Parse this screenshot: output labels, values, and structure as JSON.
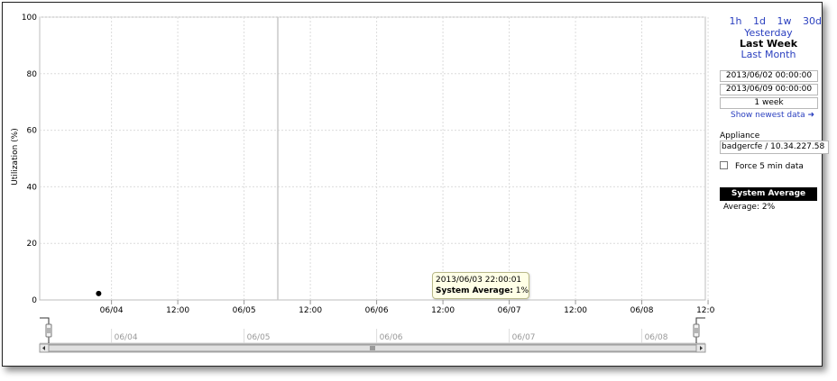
{
  "chart": {
    "ylabel": "Utilization (%)",
    "ylim": [
      0,
      100
    ],
    "y_ticks": [
      "100",
      "80",
      "60",
      "40",
      "20",
      "0"
    ],
    "x_ticks": [
      "06/04",
      "12:00",
      "06/05",
      "12:00",
      "06/06",
      "12:00",
      "06/07",
      "12:00",
      "06/08",
      "12:00"
    ],
    "navigator_ticks": [
      "06/04",
      "06/05",
      "06/06",
      "06/07",
      "06/08"
    ],
    "grid": true
  },
  "chart_data": {
    "type": "scatter",
    "xlabel": "",
    "ylabel": "Utilization (%)",
    "ylim": [
      0,
      100
    ],
    "series": [
      {
        "name": "System Average",
        "x": [
          "2013/06/03 22:00:01"
        ],
        "y": [
          1
        ]
      }
    ]
  },
  "tooltip": {
    "timestamp": "2013/06/03 22:00:01",
    "series_label": "System Average:",
    "value": "1%"
  },
  "sidebar": {
    "quick_ranges": [
      "1h",
      "1d",
      "1w",
      "30d"
    ],
    "ranges": [
      {
        "label": "Yesterday",
        "selected": false
      },
      {
        "label": "Last Week",
        "selected": true
      },
      {
        "label": "Last Month",
        "selected": false
      }
    ],
    "start_time": "2013/06/02 00:00:00",
    "end_time": "2013/06/09 00:00:00",
    "duration": "1 week",
    "show_newest": "Show newest data ➜",
    "appliance_label": "Appliance",
    "appliance_value": "badgercfe / 10.34.227.58",
    "force_label": "Force 5 min data",
    "force_checked": false,
    "legend_title": "System Average",
    "average_label": "Average:",
    "average_value": "2%"
  },
  "colors": {
    "link": "#2a3fbf",
    "grid": "#dcdcdc",
    "legend_bg": "#000000",
    "tooltip_bg": "#ffffe6"
  }
}
